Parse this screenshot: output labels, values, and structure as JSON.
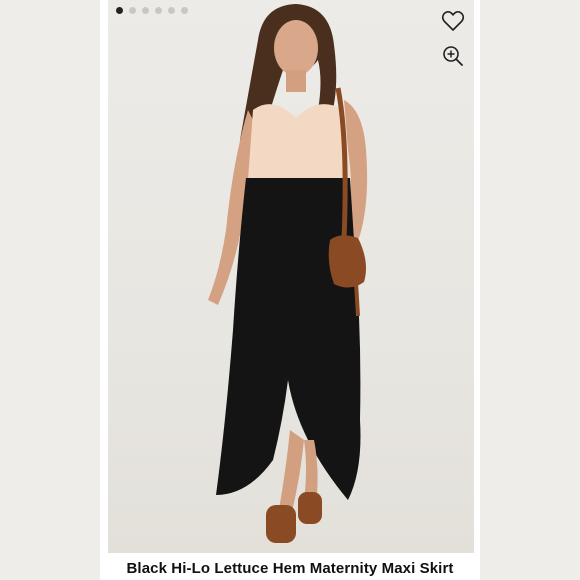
{
  "carousel": {
    "dot_count": 6,
    "active_index": 0
  },
  "actions": {
    "favorite_icon": "heart-outline-icon",
    "zoom_icon": "zoom-in-icon"
  },
  "product": {
    "title": "Black Hi-Lo Lettuce Hem Maternity Maxi Skirt"
  },
  "colors": {
    "skirt": "#141414",
    "top": "#f3d9c4",
    "bag": "#8a4a24",
    "background": "#ecebe7"
  }
}
